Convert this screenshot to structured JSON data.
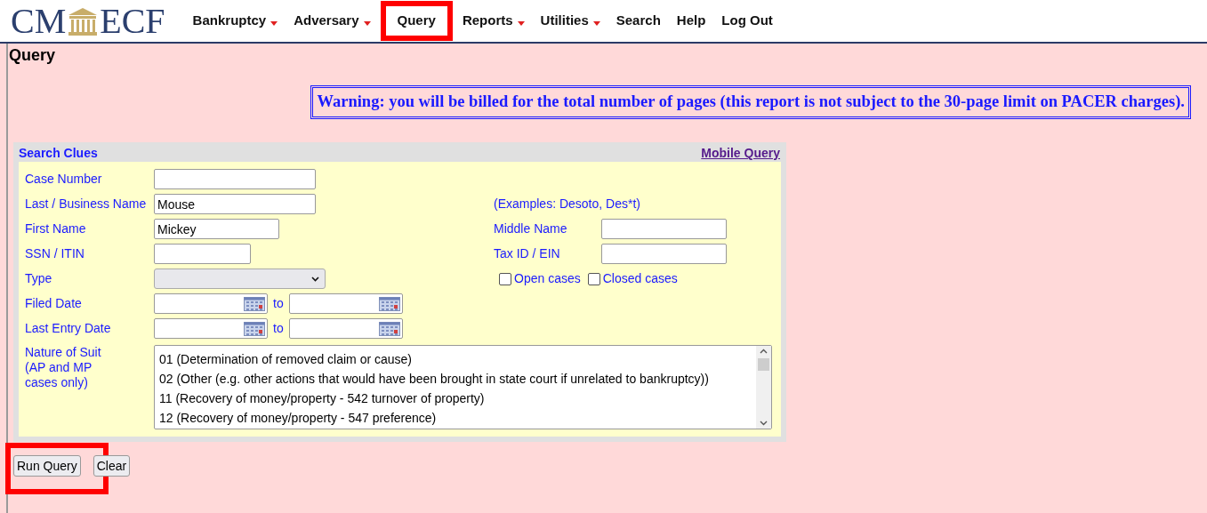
{
  "logo": {
    "left": "CM",
    "right": "ECF"
  },
  "menu": [
    {
      "label": "Bankruptcy",
      "has_dropdown": true,
      "highlighted": false
    },
    {
      "label": "Adversary",
      "has_dropdown": true,
      "highlighted": false
    },
    {
      "label": "Query",
      "has_dropdown": false,
      "highlighted": true
    },
    {
      "label": "Reports",
      "has_dropdown": true,
      "highlighted": false
    },
    {
      "label": "Utilities",
      "has_dropdown": true,
      "highlighted": false
    },
    {
      "label": "Search",
      "has_dropdown": false,
      "highlighted": false
    },
    {
      "label": "Help",
      "has_dropdown": false,
      "highlighted": false
    },
    {
      "label": "Log Out",
      "has_dropdown": false,
      "highlighted": false
    }
  ],
  "page_title": "Query",
  "warning": "Warning: you will be billed for the total number of pages (this report is not subject to the 30-page limit on PACER charges).",
  "form": {
    "title": "Search Clues",
    "mobile_link": "Mobile Query",
    "rows": [
      {
        "kind": "text",
        "label": "Case Number",
        "value": ""
      },
      {
        "kind": "text",
        "label": "Last / Business Name",
        "value": "Mouse",
        "note": "(Examples: Desoto, Des*t)"
      },
      {
        "kind": "text",
        "label": "First Name",
        "value": "Mickey",
        "right_label": "Middle Name"
      },
      {
        "kind": "text",
        "label": "SSN / ITIN",
        "value": "",
        "right_label": "Tax ID / EIN"
      },
      {
        "kind": "select",
        "label": "Type",
        "checkboxes": [
          {
            "label": "Open cases",
            "checked": false
          },
          {
            "label": "Closed cases",
            "checked": false
          }
        ]
      },
      {
        "kind": "daterange",
        "label": "Filed Date",
        "separator": "to"
      },
      {
        "kind": "daterange",
        "label": "Last Entry Date",
        "separator": "to"
      }
    ],
    "suit": {
      "label_lines": [
        "Nature of Suit",
        "(AP and MP",
        "cases only)"
      ],
      "options": [
        "01 (Determination of removed claim or cause)",
        "02 (Other (e.g. other actions that would have been brought in state court if unrelated to bankruptcy))",
        "11 (Recovery of money/property - 542 turnover of property)",
        "12 (Recovery of money/property - 547 preference)"
      ]
    }
  },
  "buttons": [
    {
      "label": "Run Query",
      "highlighted": true
    },
    {
      "label": "Clear",
      "highlighted": false
    }
  ]
}
